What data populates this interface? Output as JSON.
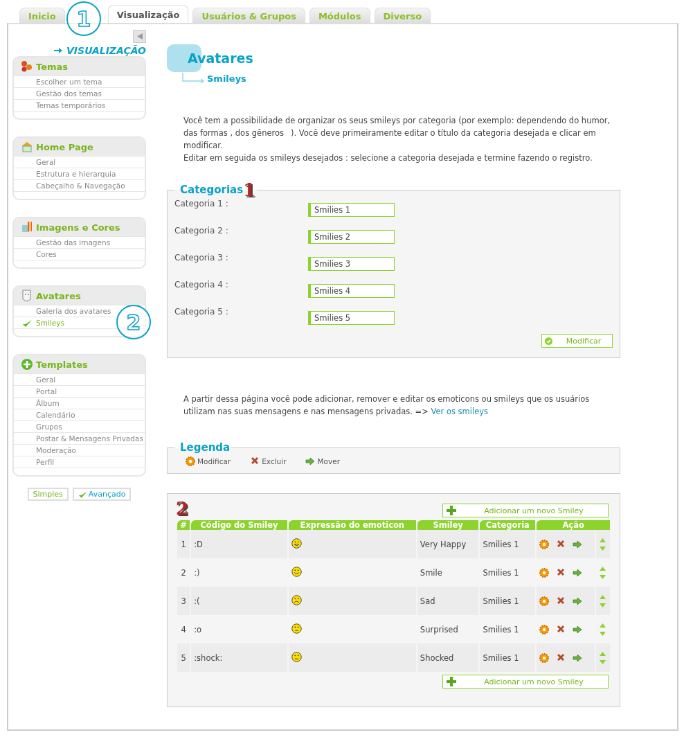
{
  "tabs": [
    {
      "label": "Inicio",
      "selected": false
    },
    {
      "label": "Visualização",
      "selected": true
    },
    {
      "label": "Usuários & Grupos",
      "selected": false
    },
    {
      "label": "Módulos",
      "selected": false
    },
    {
      "label": "Diverso",
      "selected": false
    }
  ],
  "callouts": [
    "1",
    "2"
  ],
  "sidebar": {
    "heading": "VISUALIZAÇÃO",
    "sections": [
      {
        "title": "Temas",
        "kind": "gears",
        "items": [
          {
            "label": "Escolher um tema",
            "selected": false
          },
          {
            "label": "Gestão dos temas",
            "selected": false
          },
          {
            "label": "Temas temporários",
            "selected": false
          }
        ]
      },
      {
        "title": "Home Page",
        "kind": "house",
        "items": [
          {
            "label": "Geral",
            "selected": false
          },
          {
            "label": "Estrutura e hierarquia",
            "selected": false
          },
          {
            "label": "Cabeçalho & Navegação",
            "selected": false
          }
        ]
      },
      {
        "title": "Imagens e Cores",
        "kind": "palette",
        "items": [
          {
            "label": "Gestão das imagens",
            "selected": false
          },
          {
            "label": "Cores",
            "selected": false
          }
        ]
      },
      {
        "title": "Avatares",
        "kind": "mask",
        "items": [
          {
            "label": "Galeria dos avatares",
            "selected": false
          },
          {
            "label": "Smileys",
            "selected": true
          }
        ]
      },
      {
        "title": "Templates",
        "kind": "plus",
        "items": [
          {
            "label": "Geral",
            "selected": false
          },
          {
            "label": "Portal",
            "selected": false
          },
          {
            "label": "Álbum",
            "selected": false
          },
          {
            "label": "Calendário",
            "selected": false
          },
          {
            "label": "Grupos",
            "selected": false
          },
          {
            "label": "Postar & Mensagens Privadas",
            "selected": false
          },
          {
            "label": "Moderação",
            "selected": false
          },
          {
            "label": "Perfil",
            "selected": false
          }
        ]
      }
    ],
    "modes": [
      {
        "label": "Simples",
        "selected": false
      },
      {
        "label": "Avançado",
        "selected": true
      }
    ]
  },
  "page": {
    "title": "Avatares",
    "subtitle": "Smileys",
    "intro": [
      "Você tem a possibilidade de organizar os seus smileys por categoria (por exemplo: dependendo do humor, das formas , dos gêneros). Você deve primeiramente editar o título da categoria desejada e clicar em modificar.",
      "Editar em seguida os smileys desejados : selecione a categoria desejada e termine fazendo o registro."
    ]
  },
  "categories": {
    "title": "Categorias",
    "marker": "1",
    "rows": [
      {
        "label": "Categoria 1 :",
        "value": "Smilies 1"
      },
      {
        "label": "Categoria 2 :",
        "value": "Smilies 2"
      },
      {
        "label": "Categoria 3 :",
        "value": "Smilies 3"
      },
      {
        "label": "Categoria 4 :",
        "value": "Smilies 4"
      },
      {
        "label": "Categoria 5 :",
        "value": "Smilies 5"
      }
    ],
    "button": "Modificar"
  },
  "info": {
    "text": "A partir dessa página você pode adicionar, remover e editar os emoticons ou smileys que os usuários utilizam nas suas mensagens e nas mensagens privadas. =>",
    "link": "Ver os smileys"
  },
  "legend": {
    "title": "Legenda",
    "items": [
      {
        "kind": "edit",
        "label": "Modificar"
      },
      {
        "kind": "delete",
        "label": "Excluir"
      },
      {
        "kind": "move",
        "label": "Mover"
      }
    ]
  },
  "smileys": {
    "marker": "2",
    "add_button": "Adicionar um novo Smiley",
    "add_button_bottom": "Adicionar um novo Smiley",
    "columns": [
      "#",
      "Código do Smiley",
      "Expressão do emoticon",
      "Smiley",
      "Categoria",
      "Ação"
    ],
    "rows": [
      {
        "index": "1",
        "code": ":D",
        "kind": "grin",
        "name": "Very Happy",
        "category": "Smilies 1"
      },
      {
        "index": "2",
        "code": ":)",
        "kind": "smile",
        "name": "Smile",
        "category": "Smilies 1"
      },
      {
        "index": "3",
        "code": ":(",
        "kind": "sad",
        "name": "Sad",
        "category": "Smilies 1"
      },
      {
        "index": "4",
        "code": ":o",
        "kind": "surprised",
        "name": "Surprised",
        "category": "Smilies 1"
      },
      {
        "index": "5",
        "code": ":shock:",
        "kind": "shocked",
        "name": "Shocked",
        "category": "Smilies 1"
      }
    ]
  }
}
